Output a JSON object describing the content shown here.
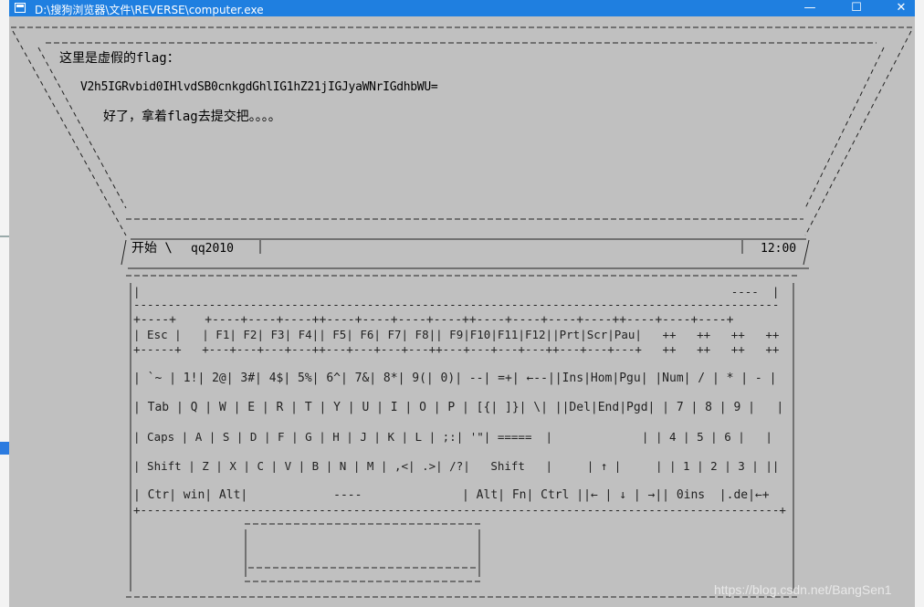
{
  "window": {
    "title": "D:\\搜狗浏览器\\文件\\REVERSE\\computer.exe",
    "controls": {
      "minimize": "—",
      "maximize": "☐",
      "close": "✕"
    }
  },
  "screen": {
    "line1": "这里是虚假的flag：",
    "line2": "V2h5IGRvbid0IHlvdSB0cnkgdGhlIG1hZ21jIGJyaWNrIGdhbWU=",
    "line3": "好了，拿着flag去提交把。。。。"
  },
  "taskbar": {
    "start": "开始 \\",
    "user": "qq2010",
    "clock": "12:00"
  },
  "keyboard": {
    "border_top": "+--------------------------------------------------------------------------------------------+",
    "row0": "|                                                                                      ----  |",
    "row0b": "----------------------------------------------------------------------------------------------",
    "row1a": "+----+    +----+----+----++----+----+----+----++----+----+----+----++----+----+----+",
    "row1": "| Esc |   | F1| F2| F3| F4|| F5| F6| F7| F8|| F9|F10|F11|F12||Prt|Scr|Pau|   ++   ++   ++   ++",
    "row1b": "+-----+   +---+---+---+---++---+---+---+---++---+---+---+---++---+---+---+   ++   ++   ++   ++",
    "row2": "| `~ | 1!| 2@| 3#| 4$| 5%| 6^| 7&| 8*| 9(| 0)| --| =+| ←--||Ins|Hom|Pgu| |Num| / | * | - |",
    "row3": "| Tab | Q | W | E | R | T | Y | U | I | O | P | [{| ]}| \\| ||Del|End|Pgd| | 7 | 8 | 9 |   |",
    "row4": "| Caps | A | S | D | F | G | H | J | K | L | ;:| '\"| =====  |             | | 4 | 5 | 6 |   |",
    "row5": "| Shift | Z | X | C | V | B | N | M | ,<| .>| /?|   Shift   |     | ↑ |     | | 1 | 2 | 3 | ||",
    "row6": "| Ctr| win| Alt|            ----              | Alt| Fn| Ctrl ||← | ↓ | →|| 0ins  |.de|←+",
    "row6b": "+---------------------------------------------------------------------------------------------+"
  },
  "watermark": "https://blog.csdn.net/BangSen1"
}
